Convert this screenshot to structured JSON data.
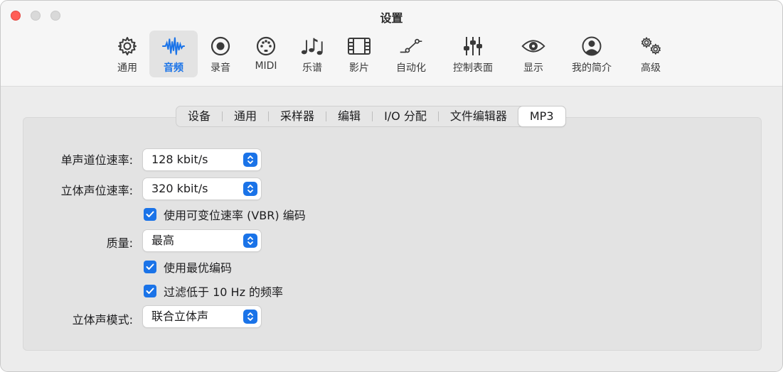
{
  "window": {
    "title": "设置"
  },
  "toolbar": {
    "items": [
      {
        "label": "通用",
        "icon": "gear-icon"
      },
      {
        "label": "音频",
        "icon": "waveform-icon",
        "selected": true
      },
      {
        "label": "录音",
        "icon": "record-icon"
      },
      {
        "label": "MIDI",
        "icon": "midi-port-icon"
      },
      {
        "label": "乐谱",
        "icon": "music-notes-icon"
      },
      {
        "label": "影片",
        "icon": "film-icon"
      },
      {
        "label": "自动化",
        "icon": "automation-curve-icon"
      },
      {
        "label": "控制表面",
        "icon": "faders-icon"
      },
      {
        "label": "显示",
        "icon": "eye-icon"
      },
      {
        "label": "我的简介",
        "icon": "person-circle-icon"
      },
      {
        "label": "高级",
        "icon": "gears-icon"
      }
    ]
  },
  "tabs": {
    "items": [
      {
        "label": "设备"
      },
      {
        "label": "通用"
      },
      {
        "label": "采样器"
      },
      {
        "label": "编辑"
      },
      {
        "label": "I/O 分配"
      },
      {
        "label": "文件编辑器"
      },
      {
        "label": "MP3",
        "active": true
      }
    ]
  },
  "form": {
    "mono_bitrate": {
      "label": "单声道位速率:",
      "value": "128 kbit/s"
    },
    "stereo_bitrate": {
      "label": "立体声位速率:",
      "value": "320 kbit/s"
    },
    "vbr": {
      "label": "使用可变位速率 (VBR) 编码",
      "checked": true
    },
    "quality": {
      "label": "质量:",
      "value": "最高"
    },
    "best_encoding": {
      "label": "使用最优编码",
      "checked": true
    },
    "filter_low": {
      "label": "过滤低于 10 Hz 的频率",
      "checked": true
    },
    "stereo_mode": {
      "label": "立体声模式:",
      "value": "联合立体声"
    }
  },
  "colors": {
    "accent": "#1a73e8",
    "close": "#ff5f57"
  }
}
